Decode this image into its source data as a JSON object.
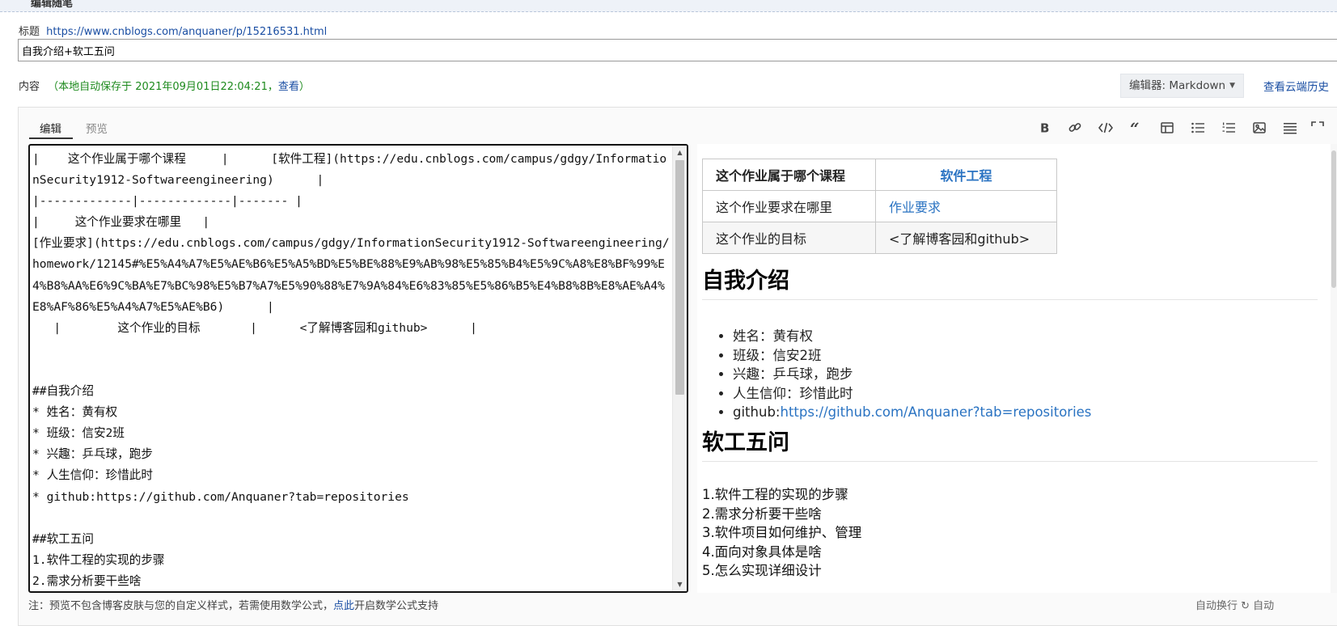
{
  "section_header": "编辑随笔",
  "title_label": "标题",
  "title_url": "https://www.cnblogs.com/anquaner/p/15216531.html",
  "title_value": "自我介绍+软工五问",
  "content_label": "内容",
  "autosave_text": "（本地自动保存于 2021年09月01日22:04:21，",
  "autosave_view": "查看",
  "autosave_close": "）",
  "editor_select": "编辑器: Markdown",
  "cloud_history": "查看云端历史",
  "tabs": {
    "edit": "编辑",
    "preview": "预览"
  },
  "toolbar_icons": [
    "bold-icon",
    "link-icon",
    "code-icon",
    "quote-icon",
    "table-icon",
    "unordered-list-icon",
    "ordered-list-icon",
    "image-icon",
    "align-icon",
    "fullscreen-icon"
  ],
  "source_text": "|    这个作业属于哪个课程     |      [软件工程](https://edu.cnblogs.com/campus/gdgy/InformationSecurity1912-Softwareengineering)      |\n|-------------|-------------|------- |\n|     这个作业要求在哪里   |\n[作业要求](https://edu.cnblogs.com/campus/gdgy/InformationSecurity1912-Softwareengineering/homework/12145#%E5%A4%A7%E5%AE%B6%E5%A5%BD%E5%BE%88%E9%AB%98%E5%85%B4%E5%9C%A8%E8%BF%99%E4%B8%AA%E6%9C%BA%E7%BC%98%E5%B7%A7%E5%90%88%E7%9A%84%E6%83%85%E5%86%B5%E4%B8%8B%E8%AE%A4%E8%AF%86%E5%A4%A7%E5%AE%B6)      |\n   |        这个作业的目标       |      <了解博客园和github>      |\n\n\n##自我介绍\n* 姓名：黄有权\n* 班级：信安2班\n* 兴趣：乒乓球，跑步\n* 人生信仰：珍惜此时\n* github:https://github.com/Anquaner?tab=repositories\n\n##软工五问\n1.软件工程的实现的步骤\n2.需求分析要干些啥",
  "preview": {
    "table": [
      [
        "这个作业属于哪个课程",
        "软件工程"
      ],
      [
        "这个作业要求在哪里",
        "作业要求"
      ],
      [
        "这个作业的目标",
        "<了解博客园和github>"
      ]
    ],
    "intro_heading": "自我介绍",
    "intro_items": [
      "姓名：黄有权",
      "班级：信安2班",
      "兴趣：乒乓球，跑步",
      "人生信仰：珍惜此时"
    ],
    "github_prefix": "github:",
    "github_link": "https://github.com/Anquaner?tab=repositories",
    "five_heading": "软工五问",
    "five_items": [
      "1.软件工程的实现的步骤",
      "2.需求分析要干些啥",
      "3.软件项目如何维护、管理",
      "4.面向对象具体是啥",
      "5.怎么实现详细设计"
    ]
  },
  "footer_note": "注：预览不包含博客皮肤与您的自定义样式，若需使用数学公式，",
  "footer_link": "点此",
  "footer_tail": "开启数学公式支持",
  "footer_right": "自动换行  ↻ 自动"
}
